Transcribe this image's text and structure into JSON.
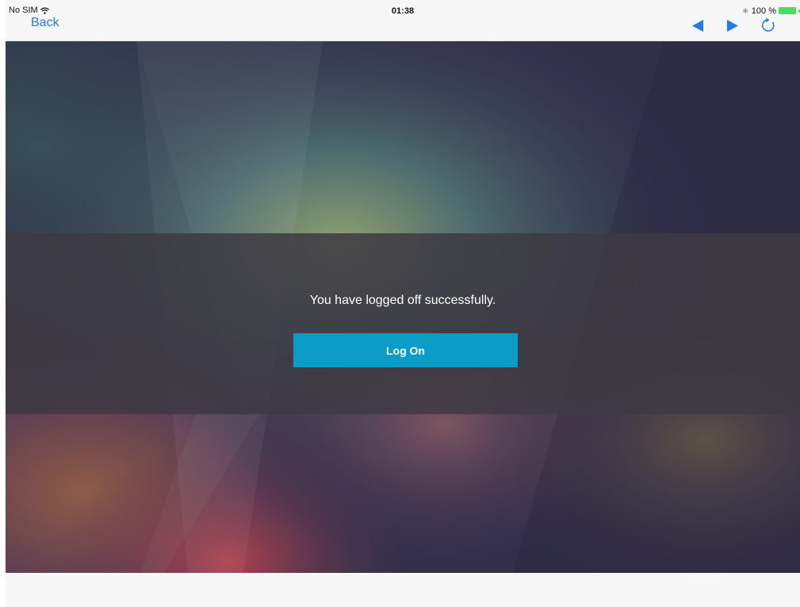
{
  "status_bar": {
    "carrier": "No SIM",
    "time": "01:38",
    "battery": "100 %",
    "icons": [
      "wifi-icon",
      "bluetooth-icon",
      "battery-icon"
    ]
  },
  "nav": {
    "back_label": "Back",
    "icons": [
      "prev-arrow-icon",
      "next-arrow-icon",
      "refresh-icon"
    ],
    "accent_color": "#1e7cf2"
  },
  "logoff": {
    "message": "You have logged off successfully.",
    "button_label": "Log On",
    "button_color": "#0b9dc7"
  }
}
